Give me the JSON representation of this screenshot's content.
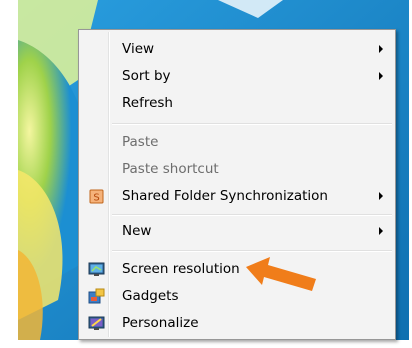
{
  "context_menu": {
    "items": [
      {
        "label": "View",
        "has_submenu": true,
        "enabled": true
      },
      {
        "label": "Sort by",
        "has_submenu": true,
        "enabled": true
      },
      {
        "label": "Refresh",
        "has_submenu": false,
        "enabled": true
      },
      {
        "label": "Paste",
        "has_submenu": false,
        "enabled": false
      },
      {
        "label": "Paste shortcut",
        "has_submenu": false,
        "enabled": false
      },
      {
        "label": "Shared Folder Synchronization",
        "has_submenu": true,
        "enabled": true,
        "icon": "sync-folder-icon"
      },
      {
        "label": "New",
        "has_submenu": true,
        "enabled": true
      },
      {
        "label": "Screen resolution",
        "has_submenu": false,
        "enabled": true,
        "icon": "monitor-icon"
      },
      {
        "label": "Gadgets",
        "has_submenu": false,
        "enabled": true,
        "icon": "gadgets-icon"
      },
      {
        "label": "Personalize",
        "has_submenu": false,
        "enabled": true,
        "icon": "personalize-icon"
      }
    ]
  },
  "annotation": {
    "icon": "orange-arrow-icon",
    "color": "#f07d1a"
  },
  "colors": {
    "menu_bg": "#f3f3f3",
    "disabled_text": "#6d6d6d",
    "desktop_blue": "#1c8fd2"
  }
}
